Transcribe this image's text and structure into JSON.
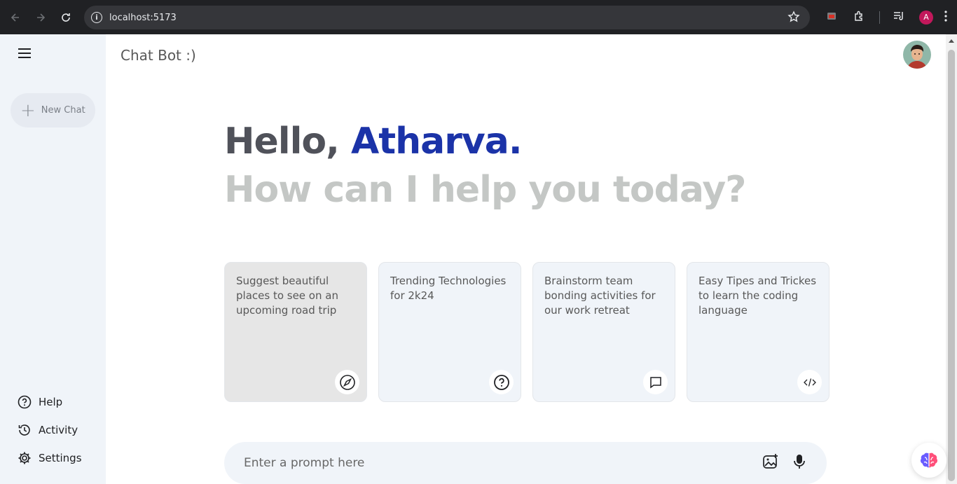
{
  "browser": {
    "url": "localhost:5173",
    "profile_initial": "A"
  },
  "sidebar": {
    "new_chat_label": "New Chat",
    "bottom_items": [
      {
        "label": "Help",
        "icon": "help-circle-icon"
      },
      {
        "label": "Activity",
        "icon": "history-icon"
      },
      {
        "label": "Settings",
        "icon": "gear-icon"
      }
    ]
  },
  "header": {
    "title": "Chat Bot :)"
  },
  "greeting": {
    "hello": "Hello, ",
    "name": "Atharva.",
    "subtitle": "How can I help you today?"
  },
  "cards": [
    {
      "text": "Suggest beautiful places to see on an upcoming road trip",
      "icon": "compass-icon"
    },
    {
      "text": "Trending Technologies for 2k24",
      "icon": "question-icon"
    },
    {
      "text": "Brainstorm team bonding activities for our work retreat",
      "icon": "message-icon"
    },
    {
      "text": "Easy Tipes and Trickes to learn the coding language",
      "icon": "code-icon"
    }
  ],
  "prompt": {
    "placeholder": "Enter a prompt here"
  },
  "colors": {
    "accent": "#1b33a8",
    "sidebar_bg": "#f0f4f9",
    "card_bg": "#f0f4f9",
    "muted_text": "#c4c7c5"
  }
}
